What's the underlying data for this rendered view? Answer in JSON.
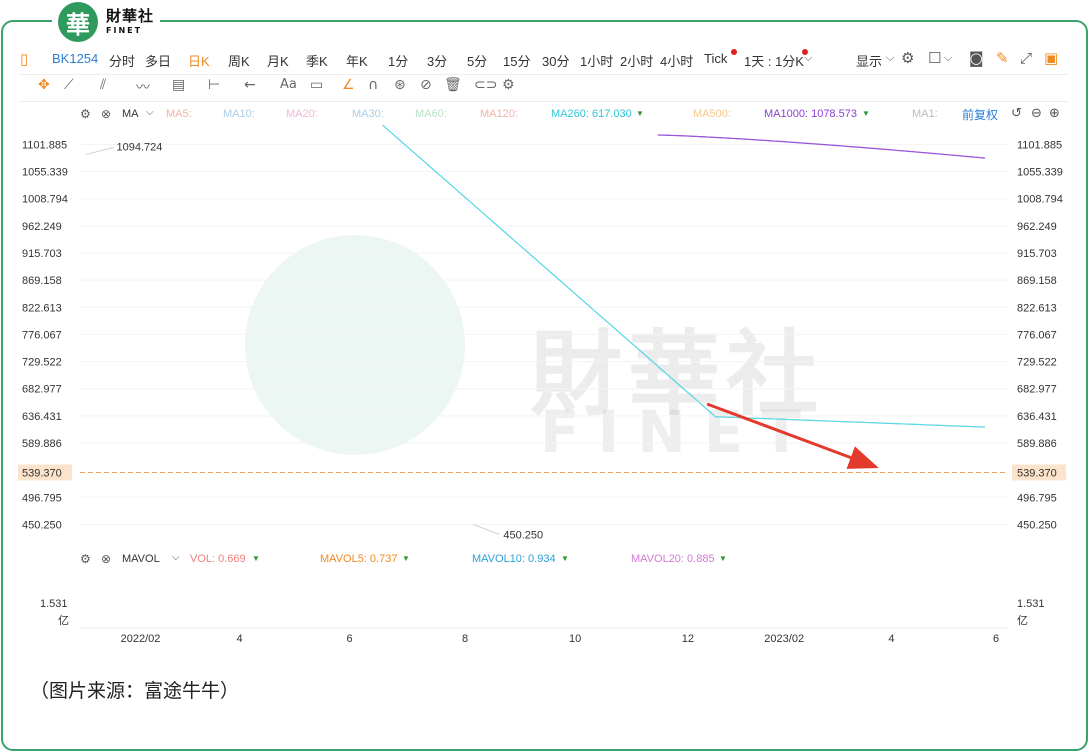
{
  "brand": {
    "logo_char": "華",
    "name_cn": "財華社",
    "name_en": "FINET"
  },
  "toolbar": {
    "code": "BK1254",
    "periods": [
      "分时",
      "多日",
      "日K",
      "周K",
      "月K",
      "季K",
      "年K",
      "1分",
      "3分",
      "5分",
      "15分",
      "30分",
      "1小时",
      "2小时",
      "4小时",
      "Tick"
    ],
    "active_period": "日K",
    "multi_period_label": "1天 : 1分K",
    "display_label": "显示",
    "icons_right": [
      "gear-icon",
      "square-icon",
      "camera-icon",
      "pencil-icon",
      "fullscreen-icon",
      "panel-icon"
    ]
  },
  "drawing_toolbar": {
    "icons": [
      "crosshair-icon",
      "line-icon",
      "channel-icon",
      "wave-icon",
      "fib-icon",
      "measure-icon",
      "arrow-icon",
      "text-icon",
      "note-icon",
      "brush-icon",
      "magnet-icon",
      "lock-icon",
      "hide-icon",
      "trash-icon",
      "link-icon",
      "settings-icon"
    ]
  },
  "ma_row": {
    "label": "MA",
    "items": [
      {
        "text": "MA5:",
        "color": "#f5b3a8"
      },
      {
        "text": "MA10:",
        "color": "#a8cfe8"
      },
      {
        "text": "MA20:",
        "color": "#f2b6d8"
      },
      {
        "text": "MA30:",
        "color": "#a8cfe8"
      },
      {
        "text": "MA60:",
        "color": "#b9e2c4"
      },
      {
        "text": "MA120:",
        "color": "#f5b3a8"
      },
      {
        "text": "MA260: 617.030",
        "color": "#2fc3d6"
      },
      {
        "text": "MA500:",
        "color": "#f5c98a"
      },
      {
        "text": "MA1000: 1078.573",
        "color": "#8a3fd6"
      },
      {
        "text": "MA1:",
        "color": "#bbbbbb"
      }
    ],
    "adjust_label": "前复权"
  },
  "mavol_row": {
    "label": "MAVOL",
    "items": [
      {
        "text": "VOL: 0.669",
        "color": "#f28080"
      },
      {
        "text": "MAVOL5: 0.737",
        "color": "#f08a24"
      },
      {
        "text": "MAVOL10: 0.934",
        "color": "#2a9fd6"
      },
      {
        "text": "MAVOL20: 0.885",
        "color": "#d27ad6"
      }
    ]
  },
  "watermark": {
    "cn": "財華社",
    "en": "FINET"
  },
  "caption": "（图片来源：富途牛牛）",
  "colors": {
    "up": "#e54545",
    "down": "#2f9a2f",
    "ma260": "#5fd8e6",
    "ma1000": "#9a55d8",
    "arrow": "#e23b2e",
    "current": "#f0a050"
  },
  "chart_data": {
    "type": "candlestick",
    "symbol": "BK1254",
    "price_ticks": [
      1101.885,
      1055.339,
      1008.794,
      962.249,
      915.703,
      869.158,
      822.613,
      776.067,
      729.522,
      682.977,
      636.431,
      589.886,
      539.37,
      496.795,
      450.25
    ],
    "ylim": [
      415,
      1130
    ],
    "x_labels": [
      "2022/02",
      "4",
      "6",
      "8",
      "10",
      "12",
      "2023/02",
      "4",
      "6"
    ],
    "annotations": {
      "high": "1094.724",
      "low": "450.250",
      "current": "539.370"
    },
    "volume_tick": "1.531",
    "volume_unit": "亿",
    "ma260_value": 617.03,
    "ma1000_value": 1078.573,
    "vol_value": 0.669,
    "candles": [],
    "volumes": []
  }
}
